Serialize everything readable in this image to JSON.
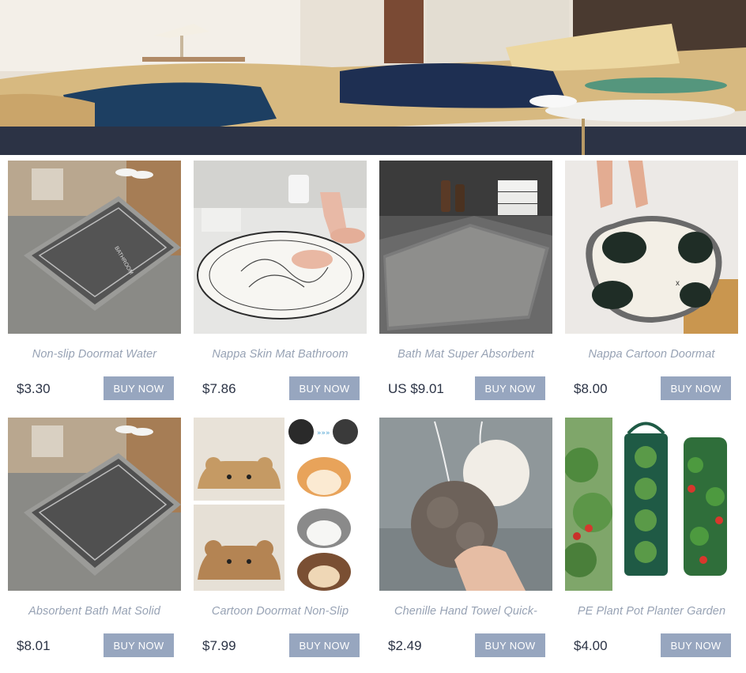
{
  "hero": {
    "image": "bedroom-banner-image"
  },
  "products": [
    {
      "title": "Non-slip Doormat Water",
      "price": "$3.30",
      "button": "BUY NOW"
    },
    {
      "title": "Nappa Skin Mat Bathroom",
      "price": "$7.86",
      "button": "BUY NOW"
    },
    {
      "title": "Bath Mat Super Absorbent",
      "price": "US $9.01",
      "button": "BUY NOW"
    },
    {
      "title": "Nappa Cartoon Doormat",
      "price": "$8.00",
      "button": "BUY NOW"
    },
    {
      "title": "Absorbent Bath Mat Solid",
      "price": "$8.01",
      "button": "BUY NOW"
    },
    {
      "title": "Cartoon Doormat Non-Slip",
      "price": "$7.99",
      "button": "BUY NOW"
    },
    {
      "title": "Chenille Hand Towel Quick-",
      "price": "$2.49",
      "button": "BUY NOW"
    },
    {
      "title": "PE Plant Pot Planter Garden",
      "price": "$4.00",
      "button": "BUY NOW"
    }
  ]
}
